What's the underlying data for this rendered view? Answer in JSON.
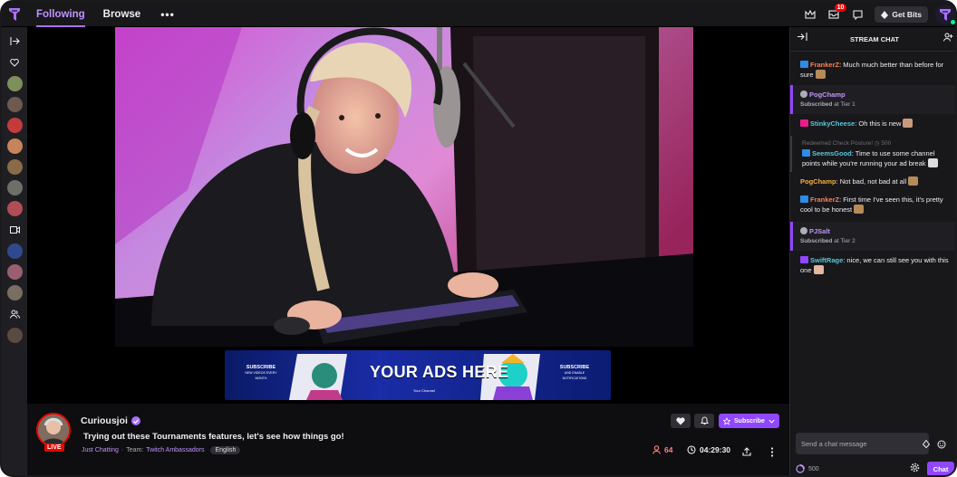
{
  "topbar": {
    "tabs": [
      {
        "label": "Following",
        "active": true
      },
      {
        "label": "Browse",
        "active": false
      }
    ],
    "more_label": "•••",
    "notification_count": "10",
    "get_bits_label": "Get Bits"
  },
  "left_rail": {
    "icons": [
      "collapse-arrow-icon",
      "heart-icon",
      "video-camera-icon",
      "people-icon"
    ],
    "avatar_colors": [
      "#7d8f5a",
      "#6c5a4e",
      "#c33b3b",
      "#c6845b",
      "#8a6a48",
      "#6f6f6a",
      "#b14d55",
      "#2f4a8c",
      "#9b5e70",
      "#7a6e62",
      "#5a4a40"
    ]
  },
  "ad_banner": {
    "title": "YOUR ADS HERE",
    "left_sub": "SUBSCRIBE",
    "left_small": "NEW VIDEOS EVERY MONTH",
    "right_sub": "SUBSCRIBE",
    "right_small": "AND ENABLE NOTIFICATIONS",
    "handle": "Your Channel"
  },
  "stream_info": {
    "channel_name": "Curiousjoi",
    "live_label": "LIVE",
    "title": "Trying out these Tournaments features, let's see how things go!",
    "category": "Just Chatting",
    "team_prefix": "Team:",
    "team": "Twitch Ambassadors",
    "tag": "English",
    "subscribe_label": "Subscribe",
    "viewers": "64",
    "uptime": "04:29:30"
  },
  "chat": {
    "header": "STREAM CHAT",
    "messages": [
      {
        "user": "FrankerZ",
        "color": "#ff7f50",
        "text": ": Much much better than before for sure",
        "badge_color": "#2e8be6",
        "emote": true
      },
      {
        "user": "PogChamp",
        "color": "#bf94ff",
        "sub_text": "Subscribed",
        "sub_tier": " at Tier 1",
        "highlight": true
      },
      {
        "user": "StinkyCheese",
        "color": "#5bc7de",
        "text": ": Oh this is new",
        "badge_color": "#e91e8c",
        "emote": true
      },
      {
        "redeem": "Redeemed Check Posture!",
        "redeem_cost": "500",
        "user": "SeemsGood",
        "color": "#5bc7de",
        "text": ": Time to use some channel points while you're running your ad break",
        "badge_color": "#2e8be6",
        "emote": true
      },
      {
        "user": "PogChamp",
        "color": "#f6b13e",
        "text": ": Not bad, not bad at all",
        "emote": true
      },
      {
        "user": "FrankerZ",
        "color": "#ff7f50",
        "text": ": First time I've seen this, it's pretty cool to be honest",
        "badge_color": "#2e8be6",
        "emote": true
      },
      {
        "user": "PJSalt",
        "color": "#bf94ff",
        "sub_text": "Subscribed",
        "sub_tier": " at Tier 2",
        "highlight": true
      },
      {
        "user": "SwiftRage",
        "color": "#5bc7de",
        "text": ": nice, we can still see you with this one",
        "badge_color": "#9147ff",
        "emote": true
      }
    ],
    "input_placeholder": "Send a chat message",
    "points": "500",
    "chat_button": "Chat"
  },
  "colors": {
    "accent": "#9147ff",
    "accent_light": "#bf94ff",
    "live_red": "#eb0400",
    "viewer_red": "#ff8280"
  }
}
